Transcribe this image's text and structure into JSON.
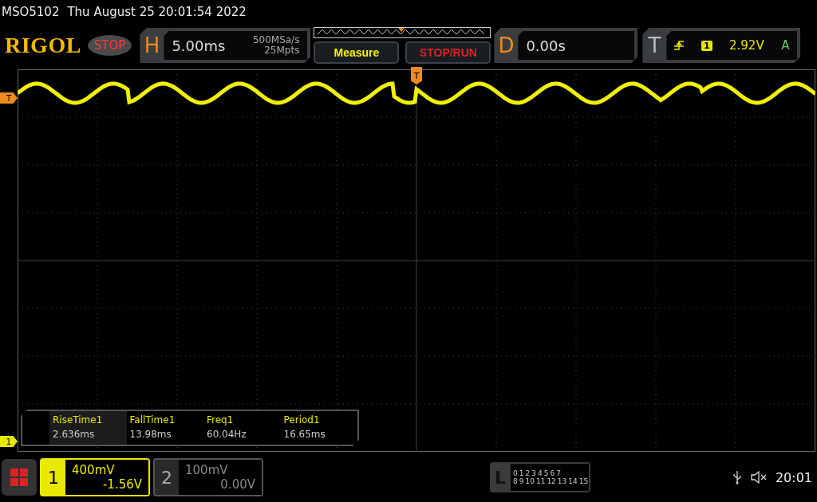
{
  "status_line": {
    "model": "MSO5102",
    "datetime": "Thu August 25 20:01:54 2022"
  },
  "logo": "RIGOL",
  "run_state": "STOP",
  "horizontal": {
    "label": "H",
    "timebase": "5.00ms",
    "sample_rate": "500MSa/s",
    "memory_depth": "25Mpts"
  },
  "buttons": [
    {
      "label": "Measure",
      "kind": "measure"
    },
    {
      "label": "STOP/RUN",
      "kind": "run"
    }
  ],
  "delay": {
    "label": "D",
    "value": "0.00s"
  },
  "trigger": {
    "label": "T",
    "source": "1",
    "level": "2.92V",
    "mode": "A"
  },
  "markers": {
    "trigger_level": "T",
    "trigger_position": "T",
    "channel": "1"
  },
  "measurements": [
    {
      "name": "RiseTime1",
      "value": "2.636ms",
      "selected": true
    },
    {
      "name": "FallTime1",
      "value": "13.98ms",
      "selected": false
    },
    {
      "name": "Freq1",
      "value": "60.04Hz",
      "selected": false
    },
    {
      "name": "Period1",
      "value": "16.65ms",
      "selected": false
    }
  ],
  "channels": [
    {
      "number": "1",
      "scale": "400mV",
      "offset": "-1.56V",
      "on": true
    },
    {
      "number": "2",
      "scale": "100mV",
      "offset": "0.00V",
      "on": false
    }
  ],
  "logic": {
    "label": "L",
    "row_1": [
      "0",
      "1",
      "2",
      "3",
      "4",
      "5",
      "6",
      "7"
    ],
    "row_2": [
      "8",
      "9",
      "10",
      "11",
      "12",
      "13",
      "14",
      "15"
    ]
  },
  "clock": "20:01"
}
